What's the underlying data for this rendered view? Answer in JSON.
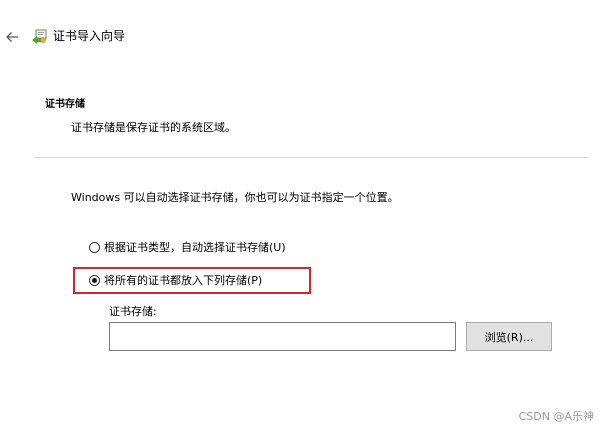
{
  "wizard": {
    "title": "证书导入向导"
  },
  "section": {
    "heading": "证书存储",
    "description": "证书存储是保存证书的系统区域。"
  },
  "intro": "Windows 可以自动选择证书存储，你也可以为证书指定一个位置。",
  "options": [
    {
      "label": "根据证书类型，自动选择证书存储(U)",
      "selected": false
    },
    {
      "label": "将所有的证书都放入下列存储(P)",
      "selected": true
    }
  ],
  "store": {
    "label": "证书存储:",
    "value": "",
    "browse_label": "浏览(R)..."
  },
  "highlight_color": "#d4262c",
  "watermark": "CSDN @A乐神"
}
